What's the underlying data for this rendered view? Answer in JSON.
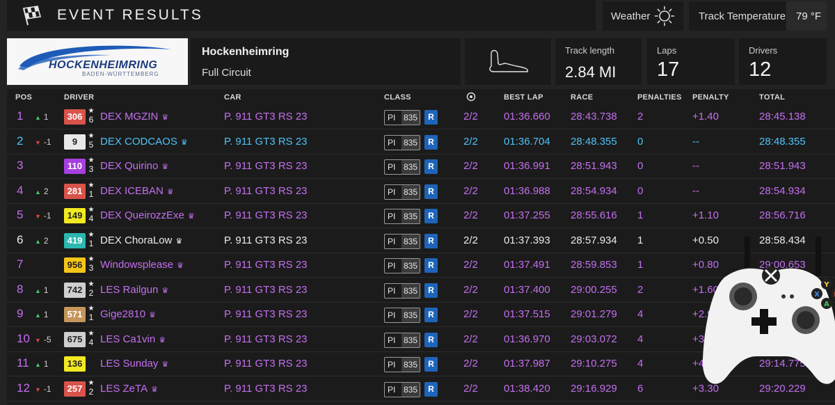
{
  "header": {
    "title": "EVENT RESULTS"
  },
  "weather": {
    "label": "Weather",
    "icon": "sun-icon"
  },
  "track_temperature": {
    "label": "Track Temperature",
    "value": "79 °F"
  },
  "logo": {
    "main": "HOCKENHEIMRING",
    "sub": "BADEN-WÜRTTEMBERG"
  },
  "track": {
    "name": "Hockenheimring",
    "layout": "Full Circuit",
    "map_icon": "track-map-icon"
  },
  "stats": {
    "track_length": {
      "label": "Track length",
      "value": "2.84 MI"
    },
    "laps": {
      "label": "Laps",
      "value": "17"
    },
    "drivers": {
      "label": "Drivers",
      "value": "12"
    }
  },
  "columns": {
    "pos": "POS",
    "driver": "DRIVER",
    "car": "CAR",
    "class": "CLASS",
    "best_lap": "BEST LAP",
    "race": "RACE",
    "penalties": "PENALTIES",
    "penalty": "PENALTY",
    "total": "TOTAL"
  },
  "colors": {
    "purple": "#c46ff0",
    "blue": "#4fc3f7",
    "white": "#ececec",
    "up": "#43c85a",
    "down": "#e0453a",
    "class_blue": "#1e64b9"
  },
  "rows": [
    {
      "pos": "1",
      "change": "1",
      "dir": "up",
      "rating": "306",
      "badge_bg": "#d9534a",
      "badge_fg": "#ffffff",
      "stars": "6",
      "driver": "DEX MGZIN",
      "car": "P. 911 GT3 RS 23",
      "pi_label": "PI",
      "pi": "835",
      "cls": "R",
      "stint": "2/2",
      "best": "01:36.660",
      "race": "28:43.738",
      "pens": "2",
      "penalty": "+1.40",
      "total": "28:45.138",
      "color": "#c46ff0",
      "time_color": "#c46ff0"
    },
    {
      "pos": "2",
      "change": "-1",
      "dir": "down",
      "rating": "9",
      "badge_bg": "#e9e9e9",
      "badge_fg": "#222222",
      "stars": "5",
      "driver": "DEX CODCAOS",
      "car": "P. 911 GT3 RS 23",
      "pi_label": "PI",
      "pi": "835",
      "cls": "R",
      "stint": "2/2",
      "best": "01:36.704",
      "race": "28:48.355",
      "pens": "0",
      "penalty": "--",
      "total": "28:48.355",
      "color": "#4fc3f7",
      "time_color": "#4fc3f7"
    },
    {
      "pos": "3",
      "change": "",
      "dir": "",
      "rating": "110",
      "badge_bg": "#a63fe0",
      "badge_fg": "#ffffff",
      "stars": "3",
      "driver": "DEX Quirino",
      "car": "P. 911 GT3 RS 23",
      "pi_label": "PI",
      "pi": "835",
      "cls": "R",
      "stint": "2/2",
      "best": "01:36.991",
      "race": "28:51.943",
      "pens": "0",
      "penalty": "--",
      "total": "28:51.943",
      "color": "#c46ff0",
      "time_color": "#c46ff0"
    },
    {
      "pos": "4",
      "change": "2",
      "dir": "up",
      "rating": "281",
      "badge_bg": "#d9534a",
      "badge_fg": "#ffffff",
      "stars": "1",
      "driver": "DEX ICEBAN",
      "car": "P. 911 GT3 RS 23",
      "pi_label": "PI",
      "pi": "835",
      "cls": "R",
      "stint": "2/2",
      "best": "01:36.988",
      "race": "28:54.934",
      "pens": "0",
      "penalty": "--",
      "total": "28:54.934",
      "color": "#c46ff0",
      "time_color": "#c46ff0"
    },
    {
      "pos": "5",
      "change": "-1",
      "dir": "down",
      "rating": "149",
      "badge_bg": "#f2ea20",
      "badge_fg": "#222222",
      "stars": "4",
      "driver": "DEX QueirozzExe",
      "car": "P. 911 GT3 RS 23",
      "pi_label": "PI",
      "pi": "835",
      "cls": "R",
      "stint": "2/2",
      "best": "01:37.255",
      "race": "28:55.616",
      "pens": "1",
      "penalty": "+1.10",
      "total": "28:56.716",
      "color": "#c46ff0",
      "time_color": "#c46ff0"
    },
    {
      "pos": "6",
      "change": "2",
      "dir": "up",
      "rating": "419",
      "badge_bg": "#2cb8b0",
      "badge_fg": "#ffffff",
      "stars": "1",
      "driver": "DEX ChoraLow",
      "car": "P. 911 GT3 RS 23",
      "pi_label": "PI",
      "pi": "835",
      "cls": "R",
      "stint": "2/2",
      "best": "01:37.393",
      "race": "28:57.934",
      "pens": "1",
      "penalty": "+0.50",
      "total": "28:58.434",
      "color": "#ececec",
      "time_color": "#ececec"
    },
    {
      "pos": "7",
      "change": "",
      "dir": "",
      "rating": "956",
      "badge_bg": "#f5c518",
      "badge_fg": "#222222",
      "stars": "3",
      "driver": "Windowsplease",
      "car": "P. 911 GT3 RS 23",
      "pi_label": "PI",
      "pi": "835",
      "cls": "R",
      "stint": "2/2",
      "best": "01:37.491",
      "race": "28:59.853",
      "pens": "1",
      "penalty": "+0.80",
      "total": "29:00.653",
      "color": "#c46ff0",
      "time_color": "#c46ff0"
    },
    {
      "pos": "8",
      "change": "1",
      "dir": "up",
      "rating": "742",
      "badge_bg": "#cfcfcf",
      "badge_fg": "#222222",
      "stars": "2",
      "driver": "LES Railgun",
      "car": "P. 911 GT3 RS 23",
      "pi_label": "PI",
      "pi": "835",
      "cls": "R",
      "stint": "2/2",
      "best": "01:37.400",
      "race": "29:00.255",
      "pens": "2",
      "penalty": "+1.60",
      "total": "",
      "color": "#c46ff0",
      "time_color": "#c46ff0"
    },
    {
      "pos": "9",
      "change": "1",
      "dir": "up",
      "rating": "571",
      "badge_bg": "#c6955a",
      "badge_fg": "#ffffff",
      "stars": "1",
      "driver": "Gige2810",
      "car": "P. 911 GT3 RS 23",
      "pi_label": "PI",
      "pi": "835",
      "cls": "R",
      "stint": "2/2",
      "best": "01:37.515",
      "race": "29:01.279",
      "pens": "4",
      "penalty": "+2.9",
      "total": "",
      "color": "#c46ff0",
      "time_color": "#c46ff0"
    },
    {
      "pos": "10",
      "change": "-5",
      "dir": "down",
      "rating": "675",
      "badge_bg": "#cfcfcf",
      "badge_fg": "#222222",
      "stars": "4",
      "driver": "LES Ca1vin",
      "car": "P. 911 GT3 RS 23",
      "pi_label": "PI",
      "pi": "835",
      "cls": "R",
      "stint": "2/2",
      "best": "01:36.970",
      "race": "29:03.072",
      "pens": "4",
      "penalty": "+3",
      "total": "",
      "color": "#c46ff0",
      "time_color": "#c46ff0"
    },
    {
      "pos": "11",
      "change": "1",
      "dir": "up",
      "rating": "136",
      "badge_bg": "#f2ea20",
      "badge_fg": "#222222",
      "stars": "",
      "driver": "LES Sunday",
      "car": "P. 911 GT3 RS 23",
      "pi_label": "PI",
      "pi": "835",
      "cls": "R",
      "stint": "2/2",
      "best": "01:37.987",
      "race": "29:10.275",
      "pens": "4",
      "penalty": "+4.",
      "total": "29:14.775",
      "color": "#c46ff0",
      "time_color": "#c46ff0"
    },
    {
      "pos": "12",
      "change": "-1",
      "dir": "down",
      "rating": "257",
      "badge_bg": "#d9534a",
      "badge_fg": "#ffffff",
      "stars": "2",
      "driver": "LES ZeTA",
      "car": "P. 911 GT3 RS 23",
      "pi_label": "PI",
      "pi": "835",
      "cls": "R",
      "stint": "2/2",
      "best": "01:38.420",
      "race": "29:16.929",
      "pens": "6",
      "penalty": "+3.30",
      "total": "29:20.229",
      "color": "#c46ff0",
      "time_color": "#c46ff0"
    }
  ],
  "controller": {
    "icon": "gamepad-icon",
    "buttons": [
      "Y",
      "X",
      "B",
      "A"
    ]
  }
}
